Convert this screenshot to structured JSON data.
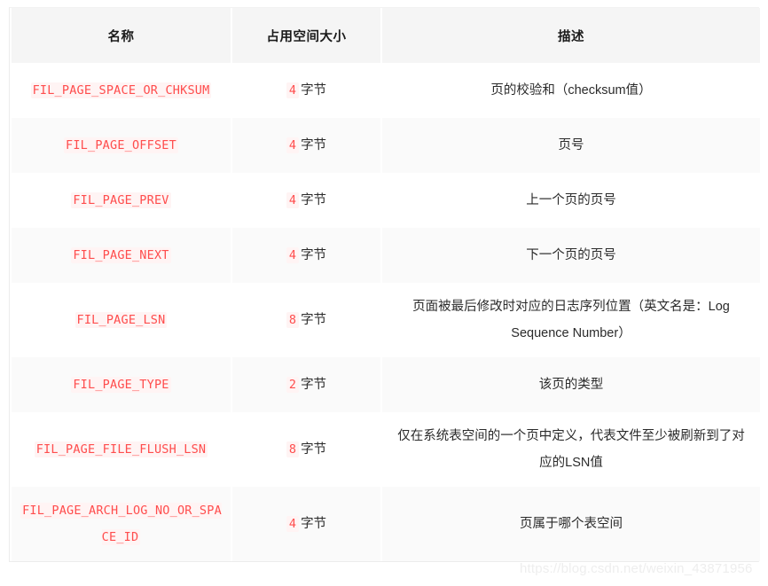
{
  "table": {
    "headers": {
      "name": "名称",
      "size": "占用空间大小",
      "description": "描述"
    },
    "rows": [
      {
        "name": "FIL_PAGE_SPACE_OR_CHKSUM",
        "size_value": "4",
        "size_unit": "字节",
        "description": "页的校验和（checksum值）"
      },
      {
        "name": "FIL_PAGE_OFFSET",
        "size_value": "4",
        "size_unit": "字节",
        "description": "页号"
      },
      {
        "name": "FIL_PAGE_PREV",
        "size_value": "4",
        "size_unit": "字节",
        "description": "上一个页的页号"
      },
      {
        "name": "FIL_PAGE_NEXT",
        "size_value": "4",
        "size_unit": "字节",
        "description": "下一个页的页号"
      },
      {
        "name": "FIL_PAGE_LSN",
        "size_value": "8",
        "size_unit": "字节",
        "description": "页面被最后修改时对应的日志序列位置（英文名是：Log Sequence Number）"
      },
      {
        "name": "FIL_PAGE_TYPE",
        "size_value": "2",
        "size_unit": "字节",
        "description": "该页的类型"
      },
      {
        "name": "FIL_PAGE_FILE_FLUSH_LSN",
        "size_value": "8",
        "size_unit": "字节",
        "description": "仅在系统表空间的一个页中定义，代表文件至少被刷新到了对应的LSN值"
      },
      {
        "name": "FIL_PAGE_ARCH_LOG_NO_OR_SPACE_ID",
        "size_value": "4",
        "size_unit": "字节",
        "description": "页属于哪个表空间"
      }
    ]
  },
  "watermark": {
    "text": "https://blog.csdn.net/weixin_43871956"
  },
  "colors": {
    "code_text": "#ff4d4d",
    "code_background": "#fff4f4",
    "header_background": "#f5f5f5",
    "row_even_background": "#fafafa",
    "row_odd_background": "#ffffff",
    "body_text": "#2b2b2b"
  }
}
